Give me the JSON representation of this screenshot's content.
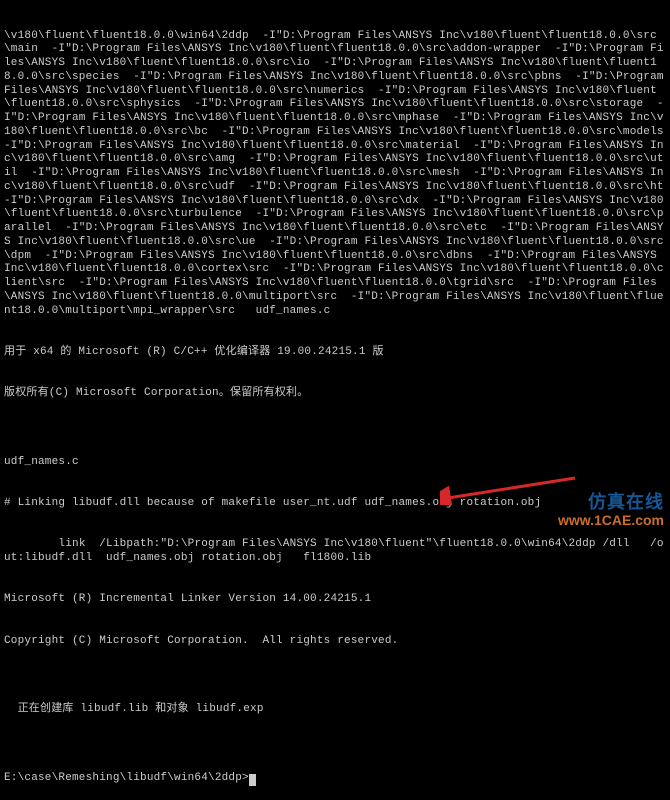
{
  "terminal": {
    "lines": [
      "\\v180\\fluent\\fluent18.0.0\\win64\\2ddp  -I\"D:\\Program Files\\ANSYS Inc\\v180\\fluent\\fluent18.0.0\\src\\main  -I\"D:\\Program Files\\ANSYS Inc\\v180\\fluent\\fluent18.0.0\\src\\addon-wrapper  -I\"D:\\Program Files\\ANSYS Inc\\v180\\fluent\\fluent18.0.0\\src\\io  -I\"D:\\Program Files\\ANSYS Inc\\v180\\fluent\\fluent18.0.0\\src\\species  -I\"D:\\Program Files\\ANSYS Inc\\v180\\fluent\\fluent18.0.0\\src\\pbns  -I\"D:\\Program Files\\ANSYS Inc\\v180\\fluent\\fluent18.0.0\\src\\numerics  -I\"D:\\Program Files\\ANSYS Inc\\v180\\fluent\\fluent18.0.0\\src\\sphysics  -I\"D:\\Program Files\\ANSYS Inc\\v180\\fluent\\fluent18.0.0\\src\\storage  -I\"D:\\Program Files\\ANSYS Inc\\v180\\fluent\\fluent18.0.0\\src\\mphase  -I\"D:\\Program Files\\ANSYS Inc\\v180\\fluent\\fluent18.0.0\\src\\bc  -I\"D:\\Program Files\\ANSYS Inc\\v180\\fluent\\fluent18.0.0\\src\\models  -I\"D:\\Program Files\\ANSYS Inc\\v180\\fluent\\fluent18.0.0\\src\\material  -I\"D:\\Program Files\\ANSYS Inc\\v180\\fluent\\fluent18.0.0\\src\\amg  -I\"D:\\Program Files\\ANSYS Inc\\v180\\fluent\\fluent18.0.0\\src\\util  -I\"D:\\Program Files\\ANSYS Inc\\v180\\fluent\\fluent18.0.0\\src\\mesh  -I\"D:\\Program Files\\ANSYS Inc\\v180\\fluent\\fluent18.0.0\\src\\udf  -I\"D:\\Program Files\\ANSYS Inc\\v180\\fluent\\fluent18.0.0\\src\\ht  -I\"D:\\Program Files\\ANSYS Inc\\v180\\fluent\\fluent18.0.0\\src\\dx  -I\"D:\\Program Files\\ANSYS Inc\\v180\\fluent\\fluent18.0.0\\src\\turbulence  -I\"D:\\Program Files\\ANSYS Inc\\v180\\fluent\\fluent18.0.0\\src\\parallel  -I\"D:\\Program Files\\ANSYS Inc\\v180\\fluent\\fluent18.0.0\\src\\etc  -I\"D:\\Program Files\\ANSYS Inc\\v180\\fluent\\fluent18.0.0\\src\\ue  -I\"D:\\Program Files\\ANSYS Inc\\v180\\fluent\\fluent18.0.0\\src\\dpm  -I\"D:\\Program Files\\ANSYS Inc\\v180\\fluent\\fluent18.0.0\\src\\dbns  -I\"D:\\Program Files\\ANSYS Inc\\v180\\fluent\\fluent18.0.0\\cortex\\src  -I\"D:\\Program Files\\ANSYS Inc\\v180\\fluent\\fluent18.0.0\\client\\src  -I\"D:\\Program Files\\ANSYS Inc\\v180\\fluent\\fluent18.0.0\\tgrid\\src  -I\"D:\\Program Files\\ANSYS Inc\\v180\\fluent\\fluent18.0.0\\multiport\\src  -I\"D:\\Program Files\\ANSYS Inc\\v180\\fluent\\fluent18.0.0\\multiport\\mpi_wrapper\\src   udf_names.c",
      "用于 x64 的 Microsoft (R) C/C++ 优化编译器 19.00.24215.1 版",
      "版权所有(C) Microsoft Corporation。保留所有权利。",
      "",
      "udf_names.c",
      "# Linking libudf.dll because of makefile user_nt.udf udf_names.obj rotation.obj",
      "        link  /Libpath:\"D:\\Program Files\\ANSYS Inc\\v180\\fluent\"\\fluent18.0.0\\win64\\2ddp /dll   /out:libudf.dll  udf_names.obj rotation.obj   fl1800.lib",
      "Microsoft (R) Incremental Linker Version 14.00.24215.1",
      "Copyright (C) Microsoft Corporation.  All rights reserved.",
      "",
      "  正在创建库 libudf.lib 和对象 libudf.exp",
      ""
    ],
    "prompt": "E:\\case\\Remeshing\\libudf\\win64\\2ddp>"
  },
  "watermark": {
    "brand": "仿真在线",
    "url": "www.1CAE.com"
  }
}
